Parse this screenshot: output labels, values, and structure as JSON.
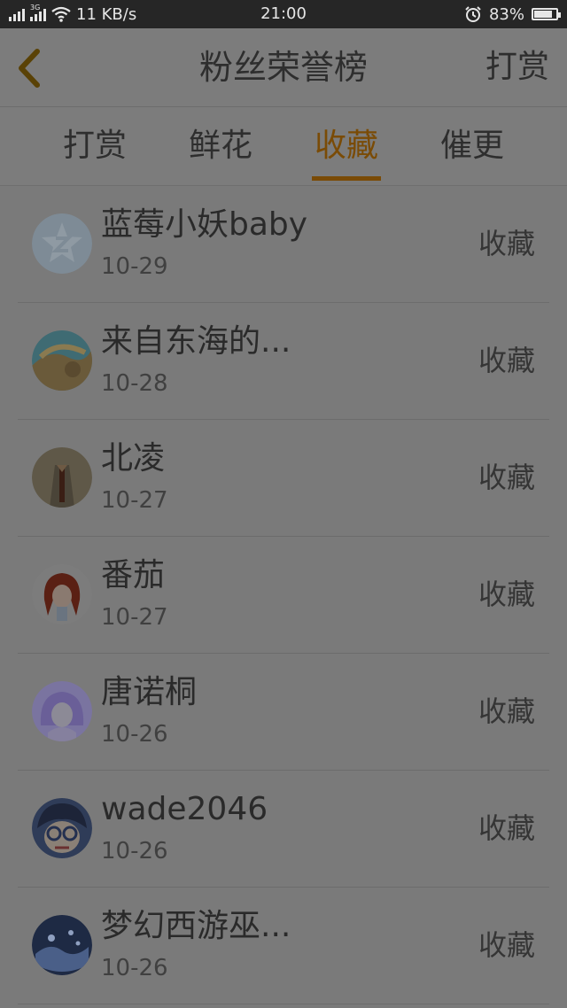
{
  "status_bar": {
    "network_speed": "11 KB/s",
    "network_type": "3G",
    "time": "21:00",
    "battery_percent": "83%",
    "battery_level": 0.83,
    "icons": [
      "signal-icon",
      "wifi-icon",
      "alarm-icon",
      "battery-icon"
    ]
  },
  "header": {
    "title": "粉丝荣誉榜",
    "action_label": "打赏",
    "back_icon": "chevron-left-icon"
  },
  "tabs": {
    "items": [
      {
        "label": "打赏"
      },
      {
        "label": "鲜花"
      },
      {
        "label": "收藏"
      },
      {
        "label": "催更"
      }
    ],
    "active_index": 2
  },
  "list": {
    "items": [
      {
        "name": "蓝莓小妖baby",
        "date": "10-29",
        "action": "收藏",
        "avatar": "default-avatar-icon"
      },
      {
        "name": "来自东海的...",
        "date": "10-28",
        "action": "收藏",
        "avatar": "anime-avatar"
      },
      {
        "name": "北凌",
        "date": "10-27",
        "action": "收藏",
        "avatar": "photo-avatar"
      },
      {
        "name": "番茄",
        "date": "10-27",
        "action": "收藏",
        "avatar": "cartoon-girl-avatar"
      },
      {
        "name": "唐诺桐",
        "date": "10-26",
        "action": "收藏",
        "avatar": "anime-girl-avatar"
      },
      {
        "name": "wade2046",
        "date": "10-26",
        "action": "收藏",
        "avatar": "conan-avatar"
      },
      {
        "name": "梦幻西游巫...",
        "date": "10-26",
        "action": "收藏",
        "avatar": "game-avatar"
      }
    ]
  },
  "colors": {
    "accent": "#7a4b06",
    "overlay_background": "#7a7a7a",
    "status_bar": "#262626"
  }
}
